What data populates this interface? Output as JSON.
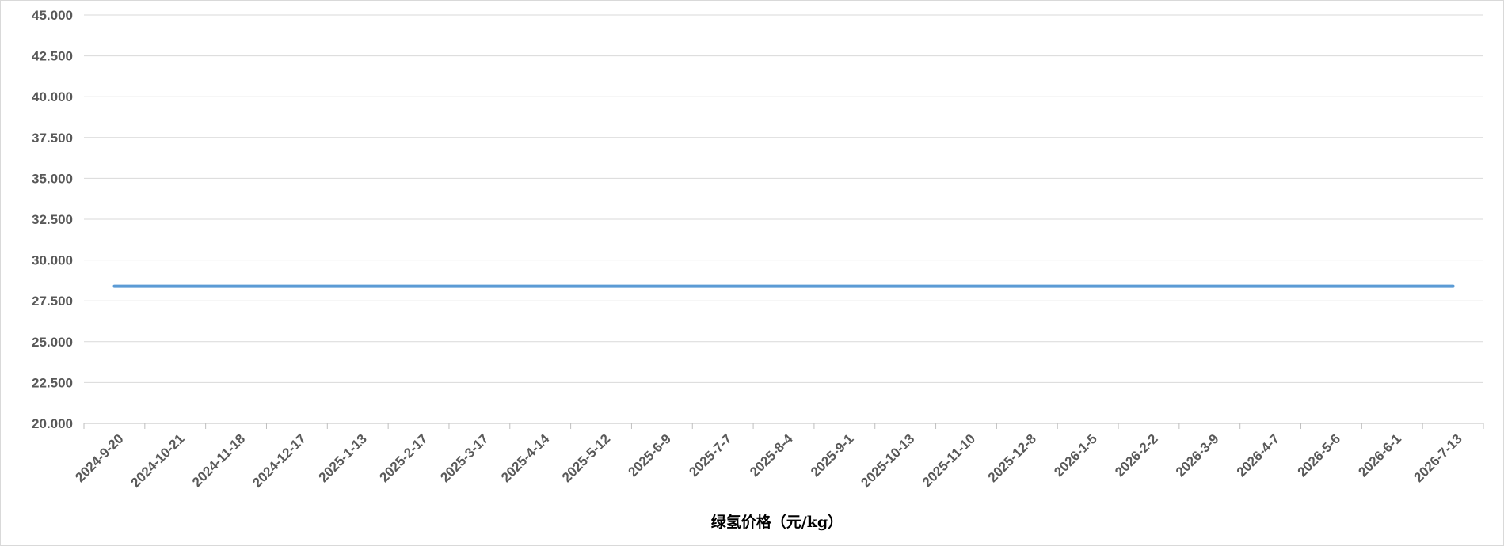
{
  "chart_data": {
    "type": "line",
    "title": "",
    "xlabel": "绿氢价格（元/kg）",
    "ylabel": "",
    "ylim": [
      20,
      45
    ],
    "y_ticks": [
      "20.000",
      "22.500",
      "25.000",
      "27.500",
      "30.000",
      "32.500",
      "35.000",
      "37.500",
      "40.000",
      "42.500",
      "45.000"
    ],
    "grid": true,
    "legend": "none",
    "categories": [
      "2024-9-20",
      "2024-10-21",
      "2024-11-18",
      "2024-12-17",
      "2025-1-13",
      "2025-2-17",
      "2025-3-17",
      "2025-4-14",
      "2025-5-12",
      "2025-6-9",
      "2025-7-7",
      "2025-8-4",
      "2025-9-1",
      "2025-10-13",
      "2025-11-10",
      "2025-12-8",
      "2026-1-5",
      "2026-2-2",
      "2026-3-9",
      "2026-4-7",
      "2026-5-6",
      "2026-6-1",
      "2026-7-13"
    ],
    "series": [
      {
        "color": "#5b9bd5",
        "values": [
          28.4,
          28.4,
          28.4,
          28.4,
          28.4,
          28.4,
          28.4,
          28.4,
          28.4,
          28.4,
          28.4,
          28.4,
          28.4,
          28.4,
          28.4,
          28.4,
          28.4,
          28.4,
          28.4,
          28.4,
          28.4,
          28.4,
          28.4
        ]
      }
    ],
    "colors": {
      "gridline": "#d9d9d9",
      "axis": "#bfbfbf",
      "tick_text": "#595959",
      "title_text": "#000000"
    }
  }
}
